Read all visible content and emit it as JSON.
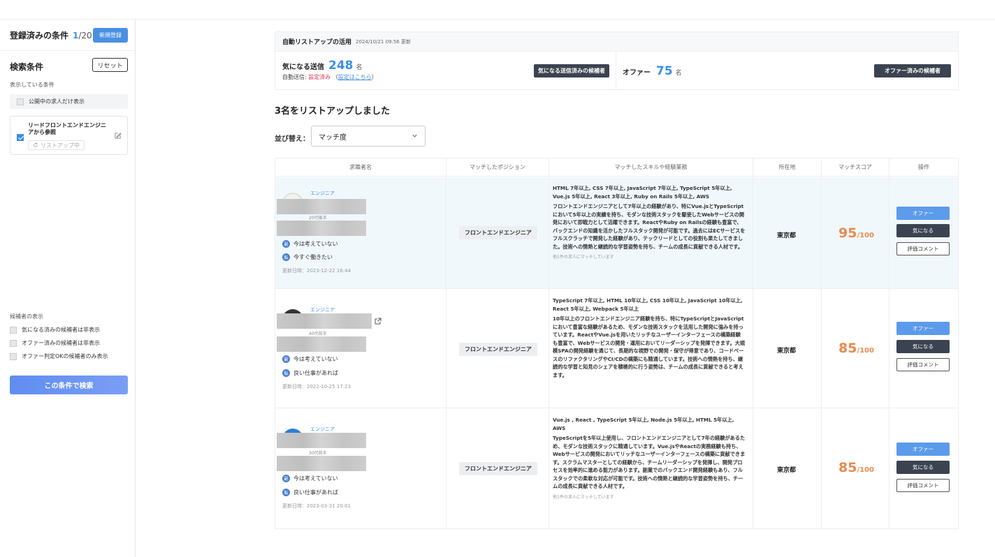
{
  "sidebar": {
    "registered_title": "登録済みの条件",
    "registered_current": "1",
    "registered_total": "/20",
    "new_button": "新規登録",
    "search_conditions_title": "検索条件",
    "reset_button": "リセット",
    "showing_label": "表示している条件",
    "public_only_label": "公開中の求人だけ表示",
    "reference_name": "リードフロントエンドエンジニアから参照",
    "reference_status": "リストアップ中",
    "display_title": "候補者の表示",
    "display_options": [
      "気になる済みの候補者は非表示",
      "オファー済みの候補者は非表示",
      "オファー判定OKの候補者のみ表示"
    ],
    "search_button": "この条件で検索"
  },
  "autolist": {
    "title": "自動リストアップの活用",
    "updated": "2024/10/21 09:56 更新",
    "interest_label": "気になる送信",
    "interest_count": "248",
    "unit": "名",
    "auto_send_prefix": "自動送信:",
    "auto_send_status": "設定済み",
    "settings_open": "（",
    "settings_link": "設定はこちら",
    "settings_close": "）",
    "interest_button": "気になる送信済みの候補者",
    "offer_label": "オファー",
    "offer_count": "75",
    "offer_button": "オファー済みの候補者"
  },
  "list": {
    "title": "3名をリストアップしました",
    "sort_label": "並び替え：",
    "sort_value": "マッチ度"
  },
  "table": {
    "headers": [
      "求職者名",
      "マッチしたポジション",
      "マッチしたスキルや経験業務",
      "所在地",
      "マッチスコア",
      "操作"
    ],
    "rows": [
      {
        "job": "エンジニア",
        "age": "20代後半",
        "side_job": "今は考えていない",
        "change_job": "今すぐ働きたい",
        "side_badge": "副",
        "change_badge": "転",
        "updated": "更新日時：2023-12-22 16:44",
        "position": "フロントエンドエンジニア",
        "skills": "HTML 7年以上, CSS 7年以上, JavaScript 7年以上, TypeScript 5年以上, Vue.js 5年以上, React 3年以上, Ruby on Rails 5年以上, AWS",
        "desc": "フロントエンドエンジニアとして7年以上の経験があり、特にVue.jsとTypeScriptにおいて5年以上の実績を持ち、モダンな技術スタックを駆使したWebサービスの開発において即戦力として活躍できます。ReactやRuby on Railsの経験も豊富で、バックエンドの知識を活かしたフルスタック開発が可能です。過去にはECサービスをフルスクラッチで開発した経験があり、テックリードとしての役割も果たしてきました。技術への情熱と継続的な学習姿勢を持ち、チームの成長に貢献できる人材です。",
        "more": "他1件の求人にマッチしています",
        "location": "東京都",
        "score": "95",
        "score_max": "/100",
        "offer": "オファー",
        "interest": "気になる",
        "comment": "評価コメント"
      },
      {
        "job": "エンジニア",
        "age": "40代前半",
        "side_job": "今は考えていない",
        "change_job": "良い仕事があれば",
        "side_badge": "副",
        "change_badge": "転",
        "updated": "更新日時：2022-10-25 17:23",
        "position": "フロントエンドエンジニア",
        "skills": "TypeScript 7年以上, HTML 10年以上, CSS 10年以上, JavaScript 10年以上, React 5年以上, Webpack 5年以上",
        "desc": "10年以上のフロントエンドエンジニア経験を持ち、特にTypeScriptとJavaScriptにおいて豊富な経験があるため、モダンな技術スタックを活用した開発に強みを持っています。ReactやVue.jsを用いたリッチなユーザーインターフェースの構築経験も豊富で、Webサービスの開発・運用においてリーダーシップを発揮できます。大規模SPAの開発経験を通じて、長期的な視野での開発・保守が得意であり、コードベースのリファクタリングやCI/CDの構築にも精通しています。技術への情熱を持ち、継続的な学習と知見のシェアを積極的に行う姿勢は、チームの成長に貢献できると考えます。",
        "more": "",
        "location": "東京都",
        "score": "85",
        "score_max": "/100",
        "offer": "オファー",
        "interest": "気になる",
        "comment": "評価コメント"
      },
      {
        "job": "エンジニア",
        "age": "30代前半",
        "side_job": "今は考えていない",
        "change_job": "良い仕事があれば",
        "side_badge": "副",
        "change_badge": "転",
        "updated": "更新日時：2023-03-31 20:01",
        "position": "フロントエンドエンジニア",
        "skills": "Vue.js , React , TypeScript 5年以上, Node.js 5年以上, HTML 5年以上, AWS",
        "desc": "TypeScriptを5年以上使用し、フロントエンドエンジニアとして7年の経験があるため、モダンな技術スタックに精通しています。Vue.jsやReactの実務経験も持ち、Webサービスの開発においてリッチなユーザーインターフェースの構築に貢献できます。スクラムマスターとしての経験から、チームリーダーシップを発揮し、開発プロセスを効率的に進める能力があります。副業でのバックエンド開発経験もあり、フルスタックでの柔軟な対応が可能です。技術への情熱と継続的な学習姿勢を持ち、チームの成長に貢献できる人材です。",
        "more": "他1件の求人にマッチしています",
        "location": "東京都",
        "score": "85",
        "score_max": "/100",
        "offer": "オファー",
        "interest": "気になる",
        "comment": "評価コメント"
      }
    ]
  },
  "colors": {
    "accent": "#3b8ee8",
    "score": "#e88b4d",
    "dark_button": "#3c4350",
    "highlight_row": "#f1f8fc"
  },
  "icons": [
    "edit-icon",
    "chevron-down-icon",
    "external-link-icon",
    "refresh-icon"
  ]
}
